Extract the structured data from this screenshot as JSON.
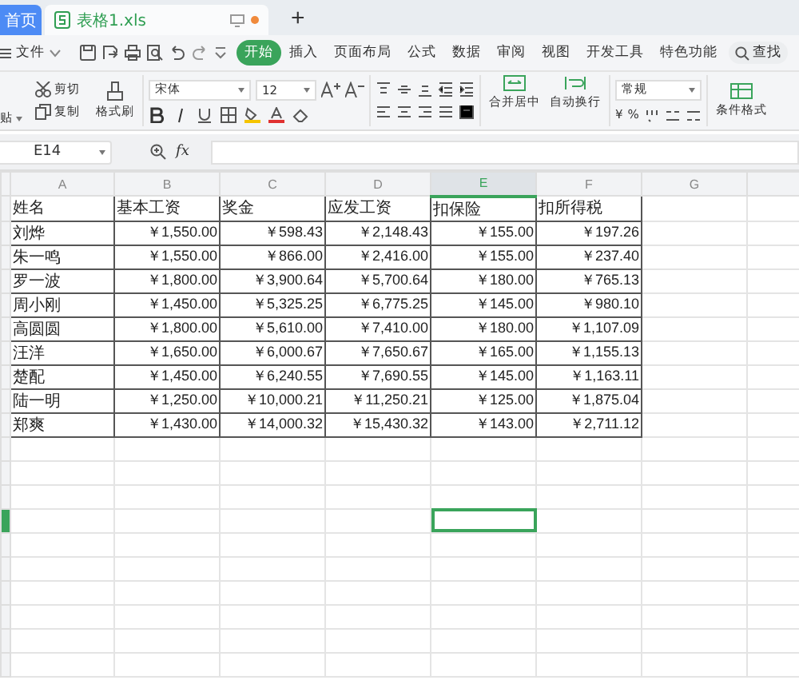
{
  "tabs": [
    {
      "label": "首页",
      "selected": false
    },
    {
      "label": "表格1.xls",
      "selected": true
    }
  ],
  "new_tab": "+",
  "menu": {
    "file": "文件",
    "items": [
      {
        "label": "开始",
        "selected": true
      },
      {
        "label": "插入",
        "selected": false
      },
      {
        "label": "页面布局",
        "selected": false
      },
      {
        "label": "公式",
        "selected": false
      },
      {
        "label": "数据",
        "selected": false
      },
      {
        "label": "审阅",
        "selected": false
      },
      {
        "label": "视图",
        "selected": false
      },
      {
        "label": "开发工具",
        "selected": false
      },
      {
        "label": "特色功能",
        "selected": false
      }
    ],
    "search": "查找"
  },
  "ribbon": {
    "paste": "贴",
    "cut": "剪切",
    "copy": "复制",
    "format_painter": "格式刷",
    "font": "宋体",
    "font_size": "12",
    "merge": "合并居中",
    "wrap": "自动换行",
    "number_format": "常规",
    "currency": "¥",
    "percent": "%",
    "conditional": "条件格式"
  },
  "formula_bar": {
    "cell": "E14",
    "fx": "fx"
  },
  "sheet": {
    "columns": [
      {
        "label": "A",
        "selected": false
      },
      {
        "label": "B",
        "selected": false
      },
      {
        "label": "C",
        "selected": false
      },
      {
        "label": "D",
        "selected": false
      },
      {
        "label": "E",
        "selected": true
      },
      {
        "label": "F",
        "selected": false
      },
      {
        "label": "G",
        "selected": false
      }
    ],
    "rows": [
      {
        "cells": [
          "姓名",
          "基本工资",
          "奖金",
          "应发工资",
          "扣保险",
          "扣所得税"
        ],
        "selected": false
      },
      {
        "cells": [
          "刘烨",
          "￥1,550.00",
          "￥598.43",
          "￥2,148.43",
          "￥155.00",
          "￥197.26"
        ],
        "selected": false
      },
      {
        "cells": [
          "朱一鸣",
          "￥1,550.00",
          "￥866.00",
          "￥2,416.00",
          "￥155.00",
          "￥237.40"
        ],
        "selected": false
      },
      {
        "cells": [
          "罗一波",
          "￥1,800.00",
          "￥3,900.64",
          "￥5,700.64",
          "￥180.00",
          "￥765.13"
        ],
        "selected": false
      },
      {
        "cells": [
          "周小刚",
          "￥1,450.00",
          "￥5,325.25",
          "￥6,775.25",
          "￥145.00",
          "￥980.10"
        ],
        "selected": false
      },
      {
        "cells": [
          "高圆圆",
          "￥1,800.00",
          "￥5,610.00",
          "￥7,410.00",
          "￥180.00",
          "￥1,107.09"
        ],
        "selected": false
      },
      {
        "cells": [
          "汪洋",
          "￥1,650.00",
          "￥6,000.67",
          "￥7,650.67",
          "￥165.00",
          "￥1,155.13"
        ],
        "selected": false
      },
      {
        "cells": [
          "楚配",
          "￥1,450.00",
          "￥6,240.55",
          "￥7,690.55",
          "￥145.00",
          "￥1,163.11"
        ],
        "selected": false
      },
      {
        "cells": [
          "陆一明",
          "￥1,250.00",
          "￥10,000.21",
          "￥11,250.21",
          "￥125.00",
          "￥1,875.04"
        ],
        "selected": false
      },
      {
        "cells": [
          "郑爽",
          "￥1,430.00",
          "￥14,000.32",
          "￥15,430.32",
          "￥143.00",
          "￥2,711.12"
        ],
        "selected": false
      },
      {
        "selected": false
      },
      {
        "selected": false
      },
      {
        "selected": false
      },
      {
        "selected": true
      },
      {
        "selected": false
      },
      {
        "selected": false
      },
      {
        "selected": false
      },
      {
        "selected": false
      },
      {
        "selected": false
      },
      {
        "selected": false
      }
    ]
  }
}
